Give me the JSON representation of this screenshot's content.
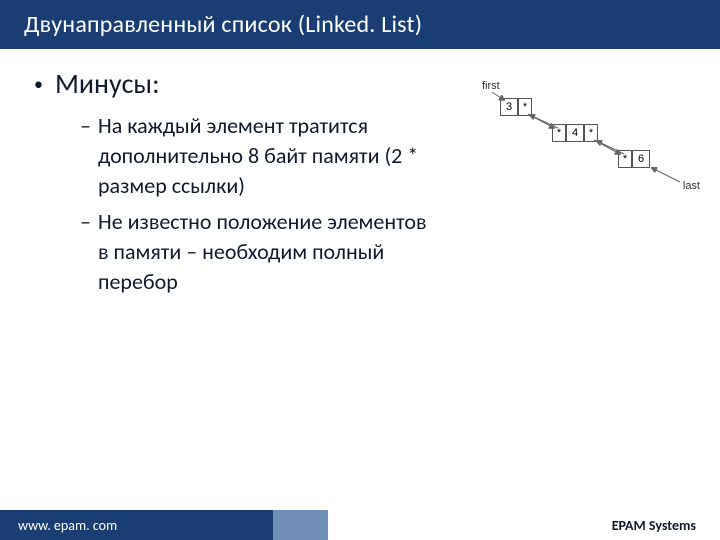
{
  "title": "Двунаправленный список (Linked. List)",
  "bullet": "Минусы:",
  "sub": [
    "На каждый элемент тратится дополнительно 8 байт памяти (2 * размер ссылки)",
    "Не известно положение элементов в памяти – необходим полный перебор"
  ],
  "diagram": {
    "firstLabel": "first",
    "lastLabel": "last",
    "nodes": [
      "3",
      "4",
      "6"
    ]
  },
  "footer": {
    "url": "www. epam. com",
    "brand": "EPAM Systems"
  }
}
